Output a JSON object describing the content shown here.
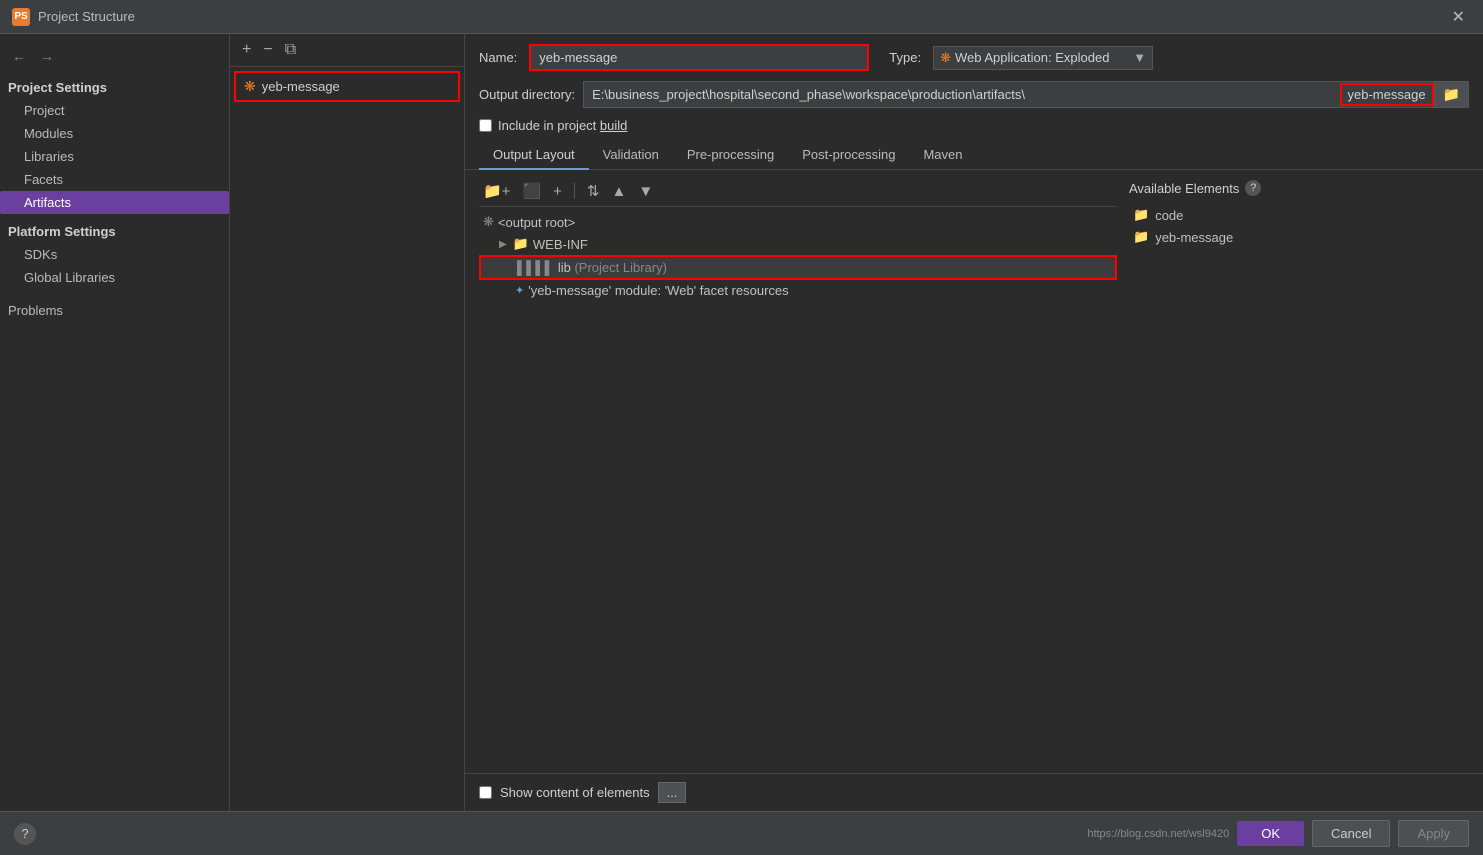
{
  "titleBar": {
    "icon": "PS",
    "title": "Project Structure",
    "closeLabel": "✕"
  },
  "sidebar": {
    "navBack": "←",
    "navForward": "→",
    "projectSettingsTitle": "Project Settings",
    "items": [
      {
        "label": "Project",
        "id": "project"
      },
      {
        "label": "Modules",
        "id": "modules"
      },
      {
        "label": "Libraries",
        "id": "libraries"
      },
      {
        "label": "Facets",
        "id": "facets"
      },
      {
        "label": "Artifacts",
        "id": "artifacts",
        "active": true
      }
    ],
    "platformSettingsTitle": "Platform Settings",
    "platformItems": [
      {
        "label": "SDKs",
        "id": "sdks"
      },
      {
        "label": "Global Libraries",
        "id": "global-libraries"
      }
    ],
    "problemsLabel": "Problems"
  },
  "artifactPanel": {
    "addBtn": "+",
    "removeBtn": "−",
    "copyBtn": "⧉",
    "item": {
      "icon": "❋",
      "label": "yeb-message"
    }
  },
  "content": {
    "nameLabel": "Name:",
    "nameValue": "yeb-message",
    "typeLabel": "Type:",
    "typeIcon": "❋",
    "typeValue": "Web Application: Exploded",
    "outputDirLabel": "Output directory:",
    "outputDirPrefix": "E:\\business_project\\hospital\\second_phase\\workspace\\production\\artifacts\\",
    "outputDirHighlight": "yeb-message",
    "outputDirBrowse": "📁",
    "includeBuildLabel": "Include in project ",
    "includeBuildUnderline": "build",
    "tabs": [
      {
        "label": "Output Layout",
        "active": true
      },
      {
        "label": "Validation"
      },
      {
        "label": "Pre-processing"
      },
      {
        "label": "Post-processing"
      },
      {
        "label": "Maven"
      }
    ],
    "treeItems": [
      {
        "label": "<output root>",
        "indent": 0,
        "type": "root",
        "icon": "❋"
      },
      {
        "label": "WEB-INF",
        "indent": 1,
        "type": "folder",
        "icon": "▶ 📁"
      },
      {
        "label": "lib  (Project Library)",
        "indent": 2,
        "type": "lib",
        "highlighted": true
      },
      {
        "label": "'yeb-message' module: 'Web' facet resources",
        "indent": 2,
        "type": "module"
      }
    ],
    "availableHeader": "Available Elements",
    "availableItems": [
      {
        "label": "code",
        "icon": "📁"
      },
      {
        "label": "yeb-message",
        "icon": "📁"
      }
    ],
    "showContentLabel": "Show content of elements",
    "dotsBtn": "..."
  },
  "footer": {
    "helpLabel": "?",
    "url": "https://blog.csdn.net/wsl9420",
    "okLabel": "OK",
    "cancelLabel": "Cancel",
    "applyLabel": "Apply"
  }
}
